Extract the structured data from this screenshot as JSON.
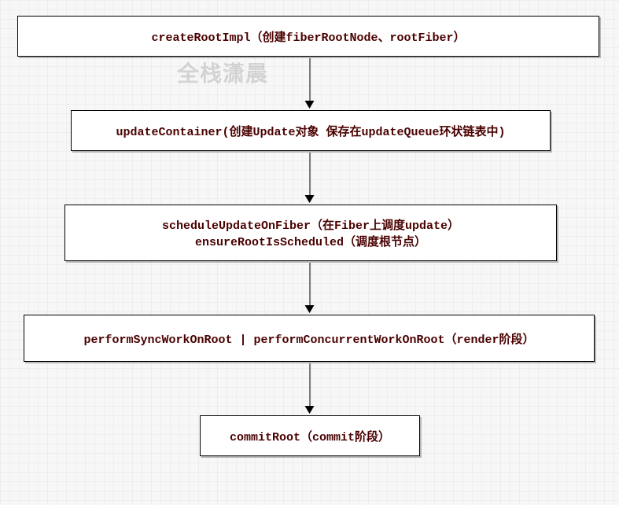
{
  "watermark": "全栈潇晨",
  "nodes": {
    "n1": {
      "label": "createRootImpl（创建fiberRootNode、rootFiber）"
    },
    "n2": {
      "label": "updateContainer(创建Update对象 保存在updateQueue环状链表中)"
    },
    "n3": {
      "line1": "scheduleUpdateOnFiber（在Fiber上调度update）",
      "line2": "ensureRootIsScheduled（调度根节点）"
    },
    "n4": {
      "label": "performSyncWorkOnRoot | performConcurrentWorkOnRoot（render阶段）"
    },
    "n5": {
      "label": "commitRoot（commit阶段）"
    }
  },
  "chart_data": {
    "type": "flowchart",
    "direction": "top-to-bottom",
    "nodes": [
      {
        "id": "n1",
        "text": "createRootImpl（创建fiberRootNode、rootFiber）"
      },
      {
        "id": "n2",
        "text": "updateContainer(创建Update对象 保存在updateQueue环状链表中)"
      },
      {
        "id": "n3",
        "text": "scheduleUpdateOnFiber（在Fiber上调度update） / ensureRootIsScheduled（调度根节点）"
      },
      {
        "id": "n4",
        "text": "performSyncWorkOnRoot | performConcurrentWorkOnRoot（render阶段）"
      },
      {
        "id": "n5",
        "text": "commitRoot（commit阶段）"
      }
    ],
    "edges": [
      {
        "from": "n1",
        "to": "n2"
      },
      {
        "from": "n2",
        "to": "n3"
      },
      {
        "from": "n3",
        "to": "n4"
      },
      {
        "from": "n4",
        "to": "n5"
      }
    ],
    "watermark": "全栈潇晨"
  }
}
